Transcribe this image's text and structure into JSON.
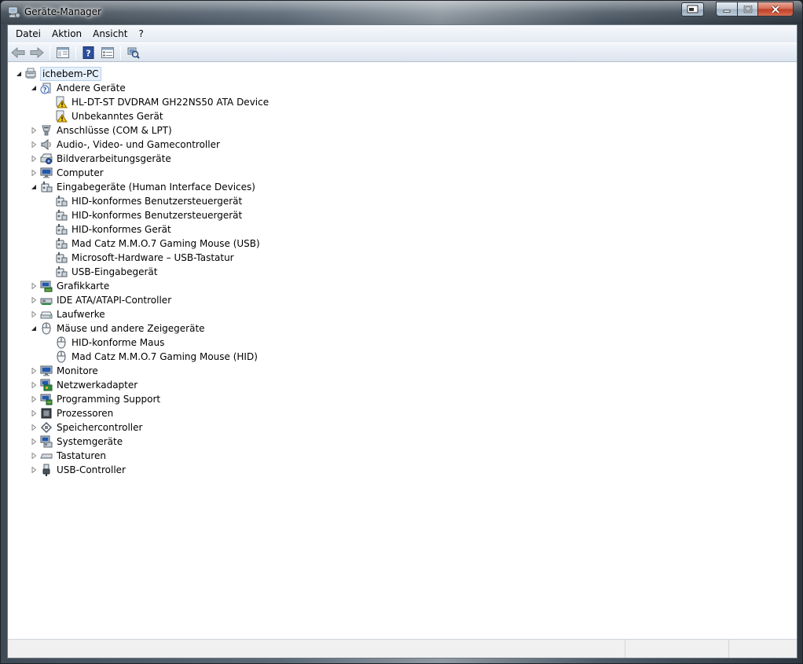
{
  "window": {
    "title": "Geräte-Manager",
    "controls": {
      "minimize": "minimize",
      "maximize": "maximize",
      "close": "close"
    }
  },
  "menu": [
    "Datei",
    "Aktion",
    "Ansicht",
    "?"
  ],
  "toolbar": {
    "buttons": [
      "back-arrow-icon",
      "forward-arrow-icon",
      "show-hide-console-tree-icon",
      "help-icon",
      "properties-icon",
      "scan-hardware-icon"
    ]
  },
  "tree": {
    "root": {
      "label": "ichebem-PC",
      "icon": "computer-root-icon",
      "expanded": true,
      "selected": true
    },
    "nodes": [
      {
        "label": "Andere Geräte",
        "icon": "unknown-device-icon",
        "expanded": true,
        "level": 1,
        "children": [
          {
            "label": "HL-DT-ST DVDRAM GH22NS50 ATA Device",
            "icon": "warning-device-icon"
          },
          {
            "label": "Unbekanntes Gerät",
            "icon": "warning-device-icon"
          }
        ]
      },
      {
        "label": "Anschlüsse (COM & LPT)",
        "icon": "port-icon",
        "expanded": false,
        "level": 1
      },
      {
        "label": "Audio-, Video- und Gamecontroller",
        "icon": "speaker-icon",
        "expanded": false,
        "level": 1
      },
      {
        "label": "Bildverarbeitungsgeräte",
        "icon": "scanner-icon",
        "expanded": false,
        "level": 1
      },
      {
        "label": "Computer",
        "icon": "monitor-icon",
        "expanded": false,
        "level": 1
      },
      {
        "label": "Eingabegeräte (Human Interface Devices)",
        "icon": "hid-icon",
        "expanded": true,
        "level": 1,
        "children": [
          {
            "label": "HID-konformes Benutzersteuergerät",
            "icon": "hid-icon"
          },
          {
            "label": "HID-konformes Benutzersteuergerät",
            "icon": "hid-icon"
          },
          {
            "label": "HID-konformes Gerät",
            "icon": "hid-icon"
          },
          {
            "label": "Mad Catz M.M.O.7 Gaming Mouse (USB)",
            "icon": "hid-icon"
          },
          {
            "label": "Microsoft-Hardware – USB-Tastatur",
            "icon": "hid-icon"
          },
          {
            "label": "USB-Eingabegerät",
            "icon": "hid-icon"
          }
        ]
      },
      {
        "label": "Grafikkarte",
        "icon": "display-adapter-icon",
        "expanded": false,
        "level": 1
      },
      {
        "label": "IDE ATA/ATAPI-Controller",
        "icon": "ide-controller-icon",
        "expanded": false,
        "level": 1
      },
      {
        "label": "Laufwerke",
        "icon": "disk-drive-icon",
        "expanded": false,
        "level": 1
      },
      {
        "label": "Mäuse und andere Zeigegeräte",
        "icon": "mouse-icon",
        "expanded": true,
        "level": 1,
        "children": [
          {
            "label": "HID-konforme Maus",
            "icon": "mouse-icon"
          },
          {
            "label": "Mad Catz M.M.O.7 Gaming Mouse (HID)",
            "icon": "mouse-icon"
          }
        ]
      },
      {
        "label": "Monitore",
        "icon": "monitor-icon",
        "expanded": false,
        "level": 1
      },
      {
        "label": "Netzwerkadapter",
        "icon": "network-adapter-icon",
        "expanded": false,
        "level": 1
      },
      {
        "label": "Programming Support",
        "icon": "programming-support-icon",
        "expanded": false,
        "level": 1
      },
      {
        "label": "Prozessoren",
        "icon": "processor-icon",
        "expanded": false,
        "level": 1
      },
      {
        "label": "Speichercontroller",
        "icon": "storage-controller-icon",
        "expanded": false,
        "level": 1
      },
      {
        "label": "Systemgeräte",
        "icon": "system-device-icon",
        "expanded": false,
        "level": 1
      },
      {
        "label": "Tastaturen",
        "icon": "keyboard-icon",
        "expanded": false,
        "level": 1
      },
      {
        "label": "USB-Controller",
        "icon": "usb-icon",
        "expanded": false,
        "level": 1
      }
    ]
  },
  "colors": {
    "selection_bg": "#e6f0fa",
    "selection_border": "#b9d1ea",
    "warning_yellow": "#f5c400",
    "close_red": "#c0402a"
  }
}
